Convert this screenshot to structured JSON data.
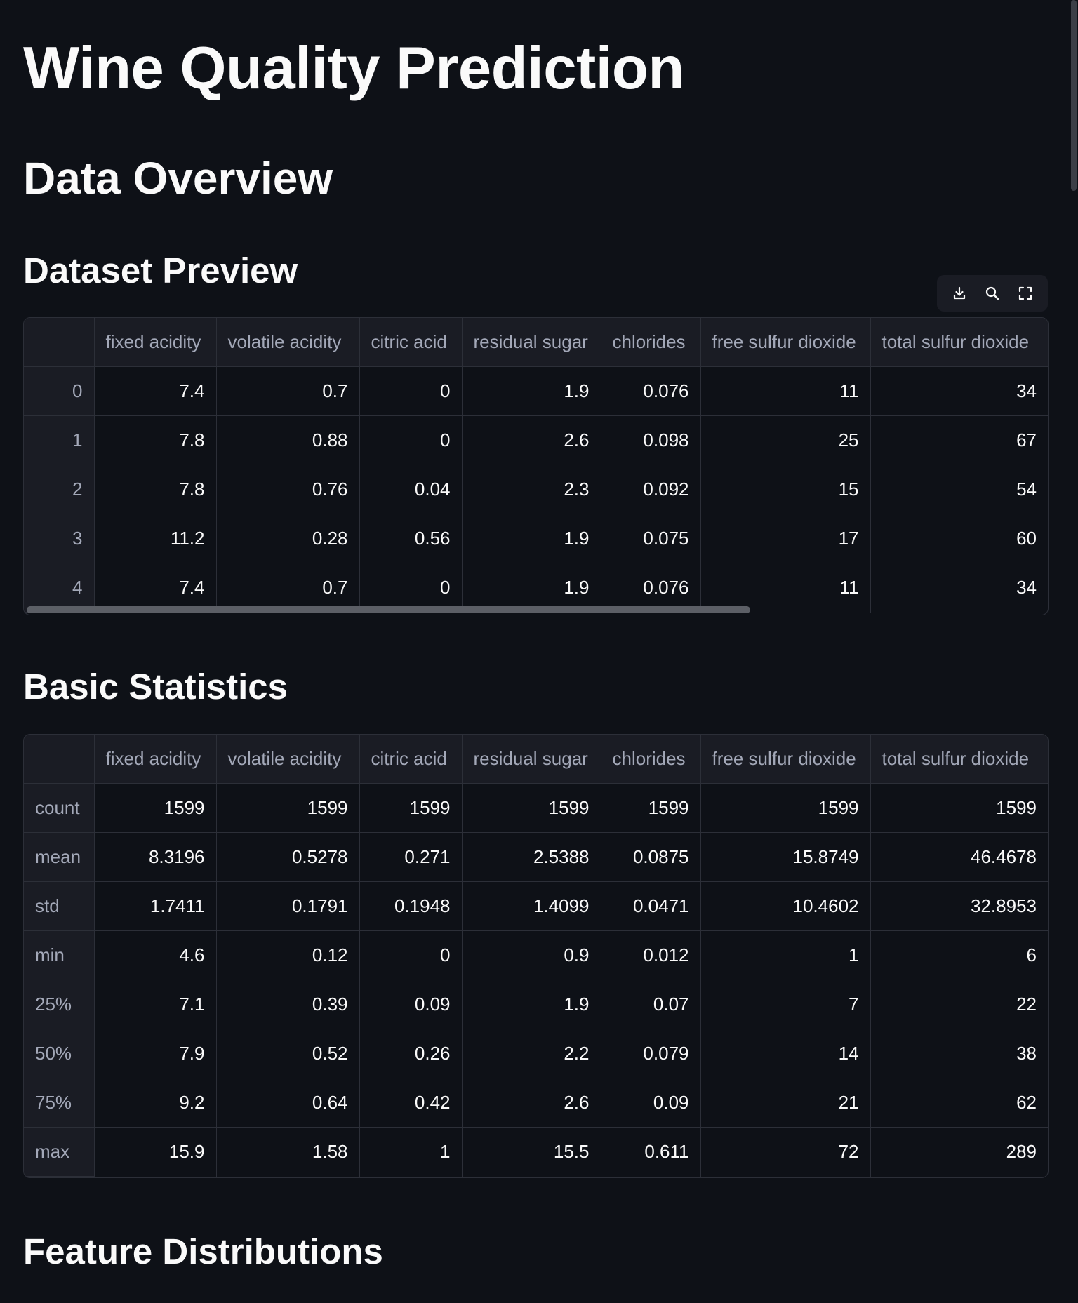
{
  "page": {
    "title": "Wine Quality Prediction",
    "section_title": "Data Overview",
    "preview_heading": "Dataset Preview",
    "stats_heading": "Basic Statistics",
    "distributions_heading": "Feature Distributions"
  },
  "toolbar": {
    "icons": [
      "download-icon",
      "search-icon",
      "fullscreen-icon"
    ]
  },
  "preview_table": {
    "columns": [
      "",
      "fixed acidity",
      "volatile acidity",
      "citric acid",
      "residual sugar",
      "chlorides",
      "free sulfur dioxide",
      "total sulfur dioxide"
    ],
    "rows": [
      [
        "0",
        "7.4",
        "0.7",
        "0",
        "1.9",
        "0.076",
        "11",
        "34"
      ],
      [
        "1",
        "7.8",
        "0.88",
        "0",
        "2.6",
        "0.098",
        "25",
        "67"
      ],
      [
        "2",
        "7.8",
        "0.76",
        "0.04",
        "2.3",
        "0.092",
        "15",
        "54"
      ],
      [
        "3",
        "11.2",
        "0.28",
        "0.56",
        "1.9",
        "0.075",
        "17",
        "60"
      ],
      [
        "4",
        "7.4",
        "0.7",
        "0",
        "1.9",
        "0.076",
        "11",
        "34"
      ]
    ]
  },
  "stats_table": {
    "columns": [
      "",
      "fixed acidity",
      "volatile acidity",
      "citric acid",
      "residual sugar",
      "chlorides",
      "free sulfur dioxide",
      "total sulfur dioxide"
    ],
    "rows": [
      [
        "count",
        "1599",
        "1599",
        "1599",
        "1599",
        "1599",
        "1599",
        "1599"
      ],
      [
        "mean",
        "8.3196",
        "0.5278",
        "0.271",
        "2.5388",
        "0.0875",
        "15.8749",
        "46.4678"
      ],
      [
        "std",
        "1.7411",
        "0.1791",
        "0.1948",
        "1.4099",
        "0.0471",
        "10.4602",
        "32.8953"
      ],
      [
        "min",
        "4.6",
        "0.12",
        "0",
        "0.9",
        "0.012",
        "1",
        "6"
      ],
      [
        "25%",
        "7.1",
        "0.39",
        "0.09",
        "1.9",
        "0.07",
        "7",
        "22"
      ],
      [
        "50%",
        "7.9",
        "0.52",
        "0.26",
        "2.2",
        "0.079",
        "14",
        "38"
      ],
      [
        "75%",
        "9.2",
        "0.64",
        "0.42",
        "2.6",
        "0.09",
        "21",
        "62"
      ],
      [
        "max",
        "15.9",
        "1.58",
        "1",
        "15.5",
        "0.611",
        "72",
        "289"
      ]
    ]
  }
}
